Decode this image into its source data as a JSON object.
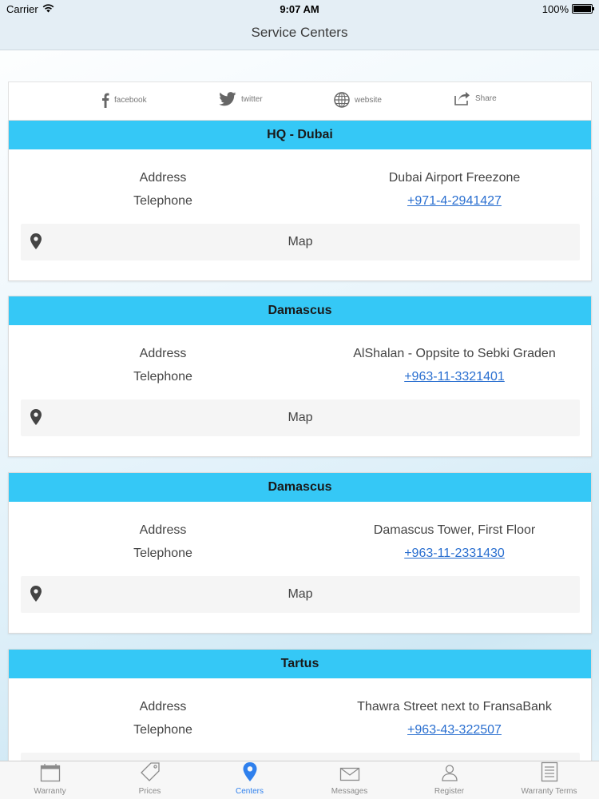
{
  "status": {
    "carrier": "Carrier",
    "time": "9:07 AM",
    "battery": "100%"
  },
  "nav": {
    "title": "Service Centers"
  },
  "share": [
    {
      "label": "facebook",
      "icon": "facebook-icon"
    },
    {
      "label": "twitter",
      "icon": "twitter-icon"
    },
    {
      "label": "website",
      "icon": "globe-icon"
    },
    {
      "label": "Share",
      "icon": "share-icon"
    }
  ],
  "labels": {
    "address": "Address",
    "telephone": "Telephone",
    "map": "Map"
  },
  "centers": [
    {
      "name": "HQ - Dubai",
      "address": "Dubai Airport Freezone",
      "phone": "+971-4-2941427"
    },
    {
      "name": "Damascus",
      "address": "AlShalan - Oppsite to Sebki Graden",
      "phone": "+963-11-3321401"
    },
    {
      "name": "Damascus",
      "address": "Damascus Tower, First Floor",
      "phone": "+963-11-2331430"
    },
    {
      "name": "Tartus",
      "address": "Thawra Street next to FransaBank",
      "phone": "+963-43-322507"
    }
  ],
  "tabs": [
    {
      "label": "Warranty",
      "icon": "calendar-icon"
    },
    {
      "label": "Prices",
      "icon": "price-tag-icon"
    },
    {
      "label": "Centers",
      "icon": "location-pin-icon"
    },
    {
      "label": "Messages",
      "icon": "envelope-icon"
    },
    {
      "label": "Register",
      "icon": "user-icon"
    },
    {
      "label": "Warranty Terms",
      "icon": "document-icon"
    }
  ],
  "colors": {
    "header": "#35c8f6",
    "link": "#2a6fd0",
    "active_tab": "#2f80ed"
  }
}
